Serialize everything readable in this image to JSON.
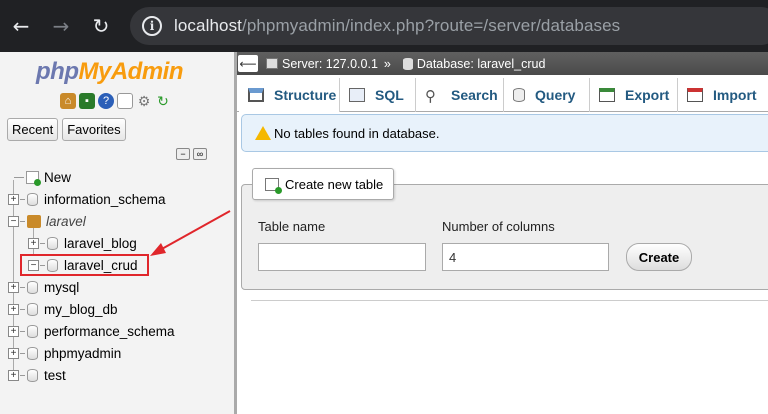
{
  "browser": {
    "url_host": "localhost",
    "url_path": "/phpmyadmin/index.php?route=/server/databases",
    "back_glyph": "←",
    "forward_glyph": "→",
    "reload_glyph": "↻",
    "info_glyph": "i"
  },
  "sidebar": {
    "logo_php": "php",
    "logo_myadmin": "MyAdmin",
    "recent_label": "Recent",
    "favorites_label": "Favorites",
    "tree": [
      {
        "label": "New",
        "kind": "new"
      },
      {
        "label": "information_schema",
        "kind": "db"
      },
      {
        "label": "laravel",
        "kind": "group"
      },
      {
        "label": "laravel_blog",
        "kind": "db-child"
      },
      {
        "label": "laravel_crud",
        "kind": "db-child-selected"
      },
      {
        "label": "mysql",
        "kind": "db"
      },
      {
        "label": "my_blog_db",
        "kind": "db"
      },
      {
        "label": "performance_schema",
        "kind": "db"
      },
      {
        "label": "phpmyadmin",
        "kind": "db"
      },
      {
        "label": "test",
        "kind": "db"
      }
    ],
    "highlight_color": "#e0262b"
  },
  "breadcrumb": {
    "server": "Server: 127.0.0.1",
    "separator": "»",
    "database": "Database: laravel_crud"
  },
  "tabs": [
    {
      "label": "Structure",
      "icon": "structure-icon"
    },
    {
      "label": "SQL",
      "icon": "sql-icon"
    },
    {
      "label": "Search",
      "icon": "search-icon"
    },
    {
      "label": "Query",
      "icon": "query-icon"
    },
    {
      "label": "Export",
      "icon": "export-icon"
    },
    {
      "label": "Import",
      "icon": "import-icon"
    }
  ],
  "notice": {
    "text": "No tables found in database."
  },
  "create_table": {
    "legend": "Create new table",
    "table_name_label": "Table name",
    "table_name_value": "",
    "columns_label": "Number of columns",
    "columns_value": "4",
    "create_button": "Create"
  },
  "colors": {
    "chrome_bg": "#202124",
    "tab_text": "#235a81",
    "annotation_red": "#e0262b",
    "notice_bg": "#e8f2fb"
  }
}
